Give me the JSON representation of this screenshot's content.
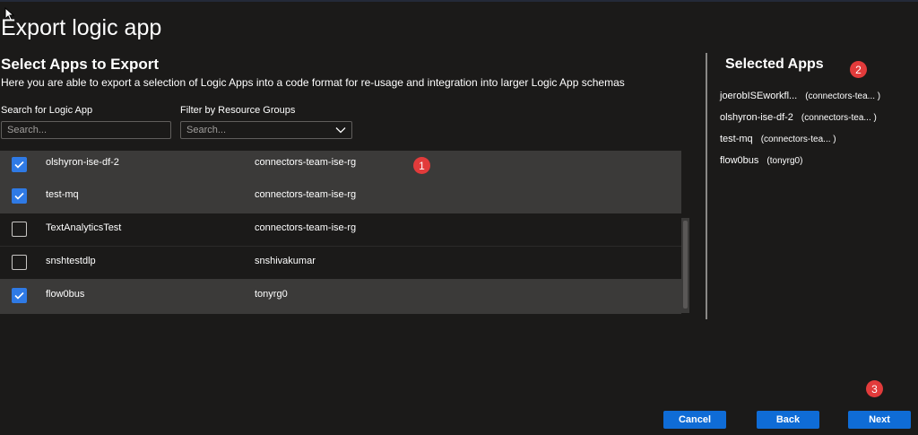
{
  "page": {
    "title": "Export logic app",
    "section_title": "Select Apps to Export",
    "section_description": "Here you are able to export a selection of Logic Apps into a code format for re-usage and integration into larger Logic App schemas"
  },
  "filters": {
    "search_label": "Search for Logic App",
    "search_placeholder": "Search...",
    "resource_group_label": "Filter by Resource Groups",
    "resource_group_placeholder": "Search..."
  },
  "apps": [
    {
      "name": "olshyron-ise-df-2",
      "resource_group": "connectors-team-ise-rg",
      "checked": true
    },
    {
      "name": "test-mq",
      "resource_group": "connectors-team-ise-rg",
      "checked": true
    },
    {
      "name": "TextAnalyticsTest",
      "resource_group": "connectors-team-ise-rg",
      "checked": false
    },
    {
      "name": "snshtestdlp",
      "resource_group": "snshivakumar",
      "checked": false
    },
    {
      "name": "flow0bus",
      "resource_group": "tonyrg0",
      "checked": true
    }
  ],
  "selected_panel": {
    "title": "Selected Apps",
    "items": [
      {
        "name": "joerobISEworkfl...",
        "resource_group": "(connectors-tea... )"
      },
      {
        "name": "olshyron-ise-df-2",
        "resource_group": "(connectors-tea... )"
      },
      {
        "name": "test-mq",
        "resource_group": "(connectors-tea... )"
      },
      {
        "name": "flow0bus",
        "resource_group": "(tonyrg0)"
      }
    ]
  },
  "badges": [
    "1",
    "2",
    "3"
  ],
  "buttons": {
    "cancel": "Cancel",
    "back": "Back",
    "next": "Next"
  },
  "icons": {
    "cursor": "mouse-pointer-icon",
    "checkmark": "checkmark-icon",
    "dropdown": "chevron-down-icon"
  },
  "colors": {
    "background": "#1b1a19",
    "selected_row": "#3b3a39",
    "checkbox_checked": "#2f7ae5",
    "primary_button": "#0f6cd6",
    "badge": "#e23b3b"
  }
}
